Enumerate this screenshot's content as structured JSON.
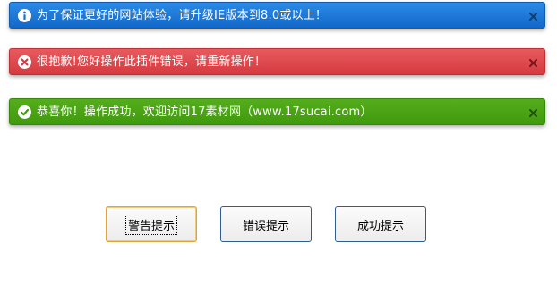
{
  "alerts": {
    "info": {
      "icon": "info-icon",
      "text": "为了保证更好的网站体验，请升级IE版本到8.0或以上！",
      "color": "#1a74d6"
    },
    "error": {
      "icon": "error-x-icon",
      "text": "很抱歉!您好操作此插件错误，请重新操作！",
      "color": "#dd4549"
    },
    "success": {
      "icon": "checkmark-icon",
      "text": "恭喜你！操作成功，欢迎访问17素材网（www.17sucai.com）",
      "color": "#46a212"
    },
    "close_icon": "close-icon"
  },
  "buttons": {
    "warning_label": "警告提示",
    "error_label": "错误提示",
    "success_label": "成功提示"
  }
}
